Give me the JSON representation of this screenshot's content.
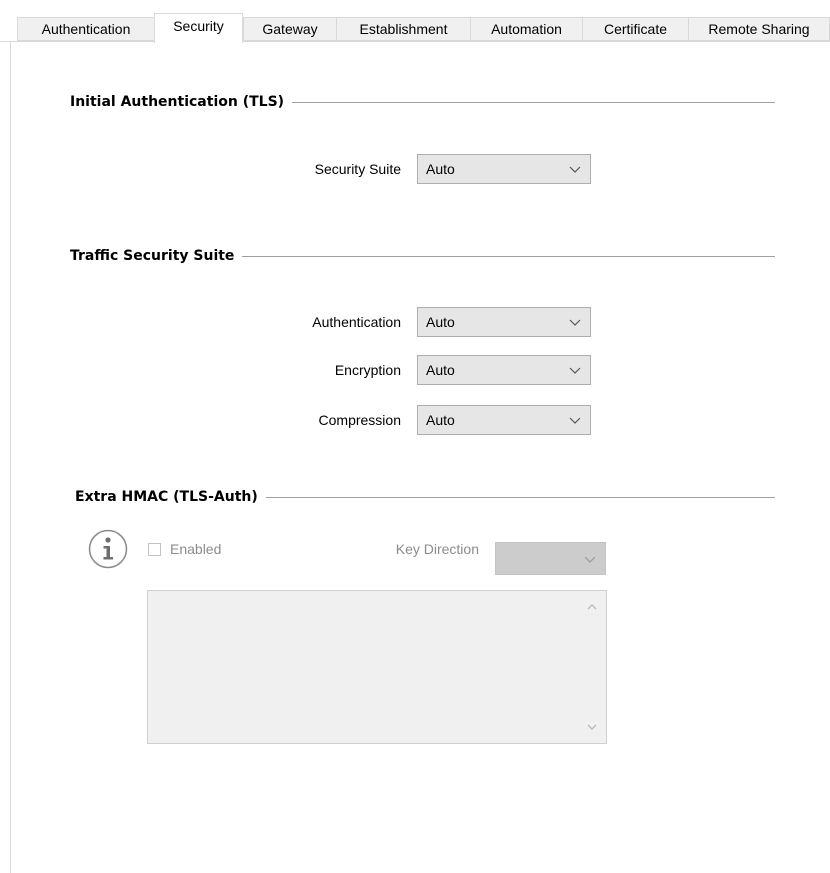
{
  "tabs": [
    {
      "label": "Authentication",
      "active": false
    },
    {
      "label": "Security",
      "active": true
    },
    {
      "label": "Gateway",
      "active": false
    },
    {
      "label": "Establishment",
      "active": false
    },
    {
      "label": "Automation",
      "active": false
    },
    {
      "label": "Certificate",
      "active": false
    },
    {
      "label": "Remote Sharing",
      "active": false
    }
  ],
  "initial_auth": {
    "title": "Initial Authentication (TLS)",
    "security_suite": {
      "label": "Security Suite",
      "value": "Auto"
    }
  },
  "traffic": {
    "title": "Traffic Security Suite",
    "authentication": {
      "label": "Authentication",
      "value": "Auto"
    },
    "encryption": {
      "label": "Encryption",
      "value": "Auto"
    },
    "compression": {
      "label": "Compression",
      "value": "Auto"
    }
  },
  "hmac": {
    "title": "Extra HMAC (TLS-Auth)",
    "info_icon": "info-icon",
    "enabled_label": "Enabled",
    "enabled_checked": false,
    "key_direction_label": "Key Direction",
    "key_direction_value": "",
    "key_text": ""
  },
  "colors": {
    "tab_inactive_bg": "#f0f0f0",
    "combo_bg": "#e6e6e6",
    "disabled_text": "#8c8c8c",
    "disabled_combo_bg": "#cccccc"
  }
}
